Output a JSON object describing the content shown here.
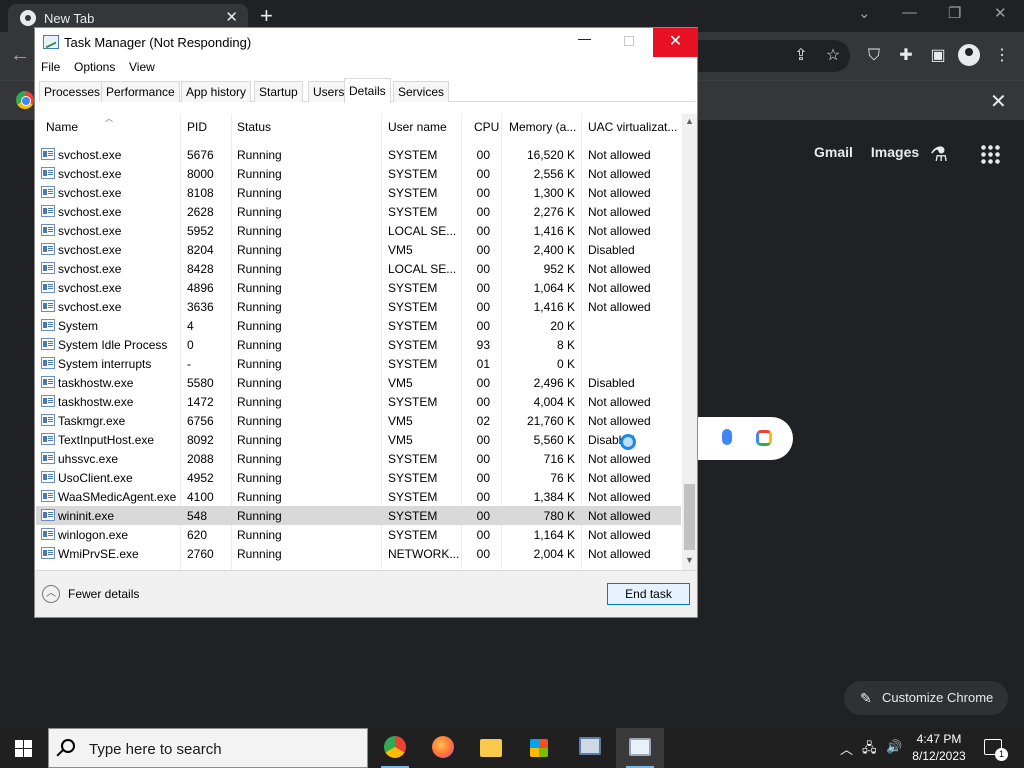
{
  "browser": {
    "tab_title": "New Tab",
    "tab_close": "✕",
    "new_tab": "+",
    "win_minimize": "—",
    "win_restore": "❐",
    "win_close": "✕",
    "links": {
      "gmail": "Gmail",
      "images": "Images"
    },
    "customize_label": "Customize Chrome"
  },
  "taskmgr": {
    "title": "Task Manager (Not Responding)",
    "menu": [
      "File",
      "Options",
      "View"
    ],
    "tabs": [
      "Processes",
      "Performance",
      "App history",
      "Startup",
      "Users",
      "Details",
      "Services"
    ],
    "active_tab": "Details",
    "columns": [
      "Name",
      "PID",
      "Status",
      "User name",
      "CPU",
      "Memory (a...",
      "UAC virtualizat..."
    ],
    "rows": [
      {
        "name": "svchost.exe",
        "pid": "5676",
        "status": "Running",
        "user": "SYSTEM",
        "cpu": "00",
        "mem": "16,520 K",
        "uac": "Not allowed"
      },
      {
        "name": "svchost.exe",
        "pid": "8000",
        "status": "Running",
        "user": "SYSTEM",
        "cpu": "00",
        "mem": "2,556 K",
        "uac": "Not allowed"
      },
      {
        "name": "svchost.exe",
        "pid": "8108",
        "status": "Running",
        "user": "SYSTEM",
        "cpu": "00",
        "mem": "1,300 K",
        "uac": "Not allowed"
      },
      {
        "name": "svchost.exe",
        "pid": "2628",
        "status": "Running",
        "user": "SYSTEM",
        "cpu": "00",
        "mem": "2,276 K",
        "uac": "Not allowed"
      },
      {
        "name": "svchost.exe",
        "pid": "5952",
        "status": "Running",
        "user": "LOCAL SE...",
        "cpu": "00",
        "mem": "1,416 K",
        "uac": "Not allowed"
      },
      {
        "name": "svchost.exe",
        "pid": "8204",
        "status": "Running",
        "user": "VM5",
        "cpu": "00",
        "mem": "2,400 K",
        "uac": "Disabled"
      },
      {
        "name": "svchost.exe",
        "pid": "8428",
        "status": "Running",
        "user": "LOCAL SE...",
        "cpu": "00",
        "mem": "952 K",
        "uac": "Not allowed"
      },
      {
        "name": "svchost.exe",
        "pid": "4896",
        "status": "Running",
        "user": "SYSTEM",
        "cpu": "00",
        "mem": "1,064 K",
        "uac": "Not allowed"
      },
      {
        "name": "svchost.exe",
        "pid": "3636",
        "status": "Running",
        "user": "SYSTEM",
        "cpu": "00",
        "mem": "1,416 K",
        "uac": "Not allowed"
      },
      {
        "name": "System",
        "pid": "4",
        "status": "Running",
        "user": "SYSTEM",
        "cpu": "00",
        "mem": "20 K",
        "uac": ""
      },
      {
        "name": "System Idle Process",
        "pid": "0",
        "status": "Running",
        "user": "SYSTEM",
        "cpu": "93",
        "mem": "8 K",
        "uac": ""
      },
      {
        "name": "System interrupts",
        "pid": "-",
        "status": "Running",
        "user": "SYSTEM",
        "cpu": "01",
        "mem": "0 K",
        "uac": ""
      },
      {
        "name": "taskhostw.exe",
        "pid": "5580",
        "status": "Running",
        "user": "VM5",
        "cpu": "00",
        "mem": "2,496 K",
        "uac": "Disabled"
      },
      {
        "name": "taskhostw.exe",
        "pid": "1472",
        "status": "Running",
        "user": "SYSTEM",
        "cpu": "00",
        "mem": "4,004 K",
        "uac": "Not allowed"
      },
      {
        "name": "Taskmgr.exe",
        "pid": "6756",
        "status": "Running",
        "user": "VM5",
        "cpu": "02",
        "mem": "21,760 K",
        "uac": "Not allowed"
      },
      {
        "name": "TextInputHost.exe",
        "pid": "8092",
        "status": "Running",
        "user": "VM5",
        "cpu": "00",
        "mem": "5,560 K",
        "uac": "Disabled"
      },
      {
        "name": "uhssvc.exe",
        "pid": "2088",
        "status": "Running",
        "user": "SYSTEM",
        "cpu": "00",
        "mem": "716 K",
        "uac": "Not allowed"
      },
      {
        "name": "UsoClient.exe",
        "pid": "4952",
        "status": "Running",
        "user": "SYSTEM",
        "cpu": "00",
        "mem": "76 K",
        "uac": "Not allowed"
      },
      {
        "name": "WaaSMedicAgent.exe",
        "pid": "4100",
        "status": "Running",
        "user": "SYSTEM",
        "cpu": "00",
        "mem": "1,384 K",
        "uac": "Not allowed"
      },
      {
        "name": "wininit.exe",
        "pid": "548",
        "status": "Running",
        "user": "SYSTEM",
        "cpu": "00",
        "mem": "780 K",
        "uac": "Not allowed",
        "selected": true
      },
      {
        "name": "winlogon.exe",
        "pid": "620",
        "status": "Running",
        "user": "SYSTEM",
        "cpu": "00",
        "mem": "1,164 K",
        "uac": "Not allowed"
      },
      {
        "name": "WmiPrvSE.exe",
        "pid": "2760",
        "status": "Running",
        "user": "NETWORK...",
        "cpu": "00",
        "mem": "2,004 K",
        "uac": "Not allowed"
      }
    ],
    "fewer_details": "Fewer details",
    "end_task": "End task"
  },
  "taskbar": {
    "search_placeholder": "Type here to search",
    "time": "4:47 PM",
    "date": "8/12/2023",
    "notification_count": "1"
  }
}
